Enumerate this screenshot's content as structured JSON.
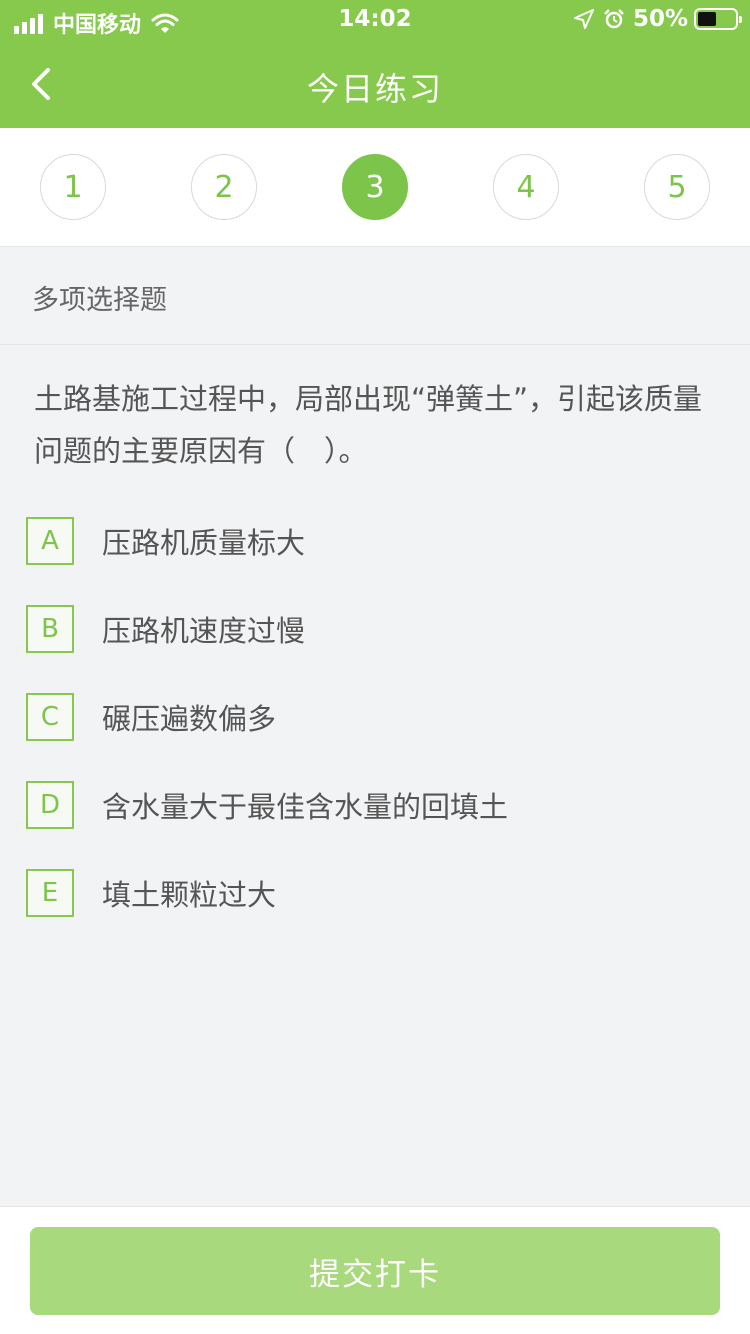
{
  "status_bar": {
    "carrier": "中国移动",
    "time": "14:02",
    "battery_percent": "50%",
    "battery_level": 0.5
  },
  "nav": {
    "title": "今日练习",
    "back_icon": "chevron-left-icon"
  },
  "question_tabs": [
    "1",
    "2",
    "3",
    "4",
    "5"
  ],
  "active_tab": "3",
  "question_type": "多项选择题",
  "question_text": "土路基施工过程中，局部出现“弹簧土”，引起该质量问题的主要原因有（　）。",
  "options": [
    {
      "letter": "A",
      "text": "压路机质量标大"
    },
    {
      "letter": "B",
      "text": "压路机速度过慢"
    },
    {
      "letter": "C",
      "text": "碾压遍数偏多"
    },
    {
      "letter": "D",
      "text": "含水量大于最佳含水量的回填土"
    },
    {
      "letter": "E",
      "text": "填土颗粒过大"
    }
  ],
  "submit_label": "提交打卡",
  "colors": {
    "primary": "#86c94c",
    "accent_text": "#7dc54a",
    "submit_disabled": "#a8d97c",
    "background": "#f2f3f5"
  }
}
